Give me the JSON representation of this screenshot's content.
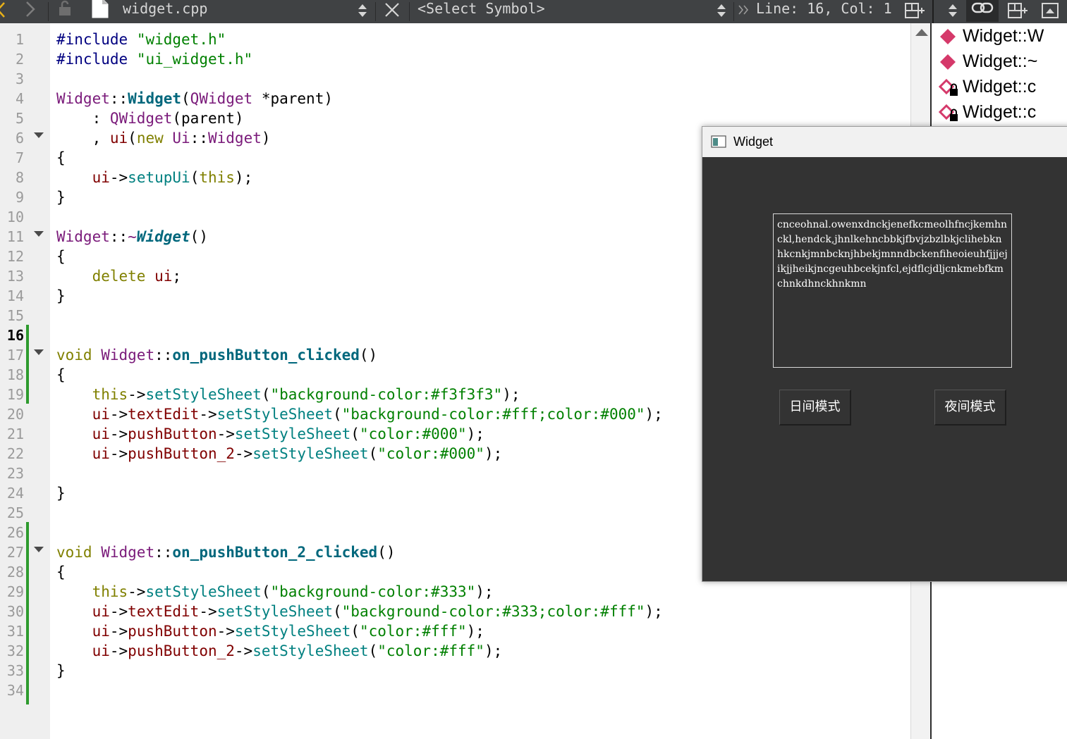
{
  "toolbar": {
    "file_name": "widget.cpp",
    "symbol_selector": "<Select Symbol>",
    "position": "Line: 16, Col: 1"
  },
  "editor": {
    "current_line": 16,
    "line_numbers": [
      "1",
      "2",
      "3",
      "4",
      "5",
      "6",
      "7",
      "8",
      "9",
      "10",
      "11",
      "12",
      "13",
      "14",
      "15",
      "16",
      "17",
      "18",
      "19",
      "20",
      "21",
      "22",
      "23",
      "24",
      "25",
      "26",
      "27",
      "28",
      "29",
      "30",
      "31",
      "32",
      "33",
      "34"
    ],
    "lines": [
      "#include \"widget.h\"",
      "#include \"ui_widget.h\"",
      "",
      "Widget::Widget(QWidget *parent)",
      "    : QWidget(parent)",
      "    , ui(new Ui::Widget)",
      "{",
      "    ui->setupUi(this);",
      "}",
      "",
      "Widget::~Widget()",
      "{",
      "    delete ui;",
      "}",
      "",
      "",
      "void Widget::on_pushButton_clicked()",
      "{",
      "    this->setStyleSheet(\"background-color:#f3f3f3\");",
      "    ui->textEdit->setStyleSheet(\"background-color:#fff;color:#000\");",
      "    ui->pushButton->setStyleSheet(\"color:#000\");",
      "    ui->pushButton_2->setStyleSheet(\"color:#000\");",
      "",
      "}",
      "",
      "",
      "void Widget::on_pushButton_2_clicked()",
      "{",
      "    this->setStyleSheet(\"background-color:#333\");",
      "    ui->textEdit->setStyleSheet(\"background-color:#333;color:#fff\");",
      "    ui->pushButton->setStyleSheet(\"color:#fff\");",
      "    ui->pushButton_2->setStyleSheet(\"color:#fff\");",
      "}",
      ""
    ]
  },
  "outline": {
    "items": [
      "Widget::W",
      "Widget::~",
      "Widget::c",
      "Widget::c"
    ]
  },
  "widget_window": {
    "title": "Widget",
    "text_edit_content": "cnceohnal.owenxdnckjenefkcmeolhfncjkemhnckl,hendck,jhnlkehncbbkjfbvjzbzlbkjclihebknhkcnkjmnbcknjhbekjmnndbckenfiheoieuhfjjjejikjjheikjncgeuhbcekjnfcl,ejdflcjdljcnkmebfkmchnkdhnckhnkmn",
    "day_mode_button": "日间模式",
    "night_mode_button": "夜间模式",
    "background_color": "#333333",
    "text_color": "#ffffff"
  },
  "colors": {
    "toolbar_bg": "#404244",
    "gutter_bg": "#efefef",
    "change_bar": "#2e9b2e",
    "class_color": "#7a1a7a",
    "string_color": "#008000",
    "keyword_color": "#808000",
    "function_color": "#00677c"
  }
}
